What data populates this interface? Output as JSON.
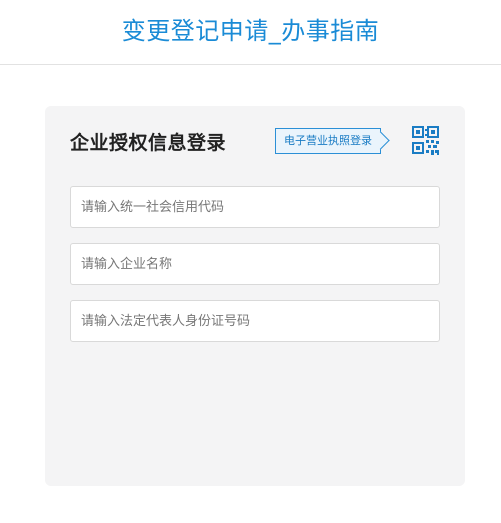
{
  "header": {
    "title": "变更登记申请_办事指南"
  },
  "login_card": {
    "title": "企业授权信息登录",
    "license_login_label": "电子营业执照登录",
    "qr_icon": "qr-code-icon",
    "fields": [
      {
        "placeholder": "请输入统一社会信用代码",
        "value": ""
      },
      {
        "placeholder": "请输入企业名称",
        "value": ""
      },
      {
        "placeholder": "请输入法定代表人身份证号码",
        "value": ""
      }
    ]
  },
  "colors": {
    "accent": "#1a8bd6",
    "card_background": "#f4f4f5",
    "license_button_border": "#2b8fd6"
  }
}
